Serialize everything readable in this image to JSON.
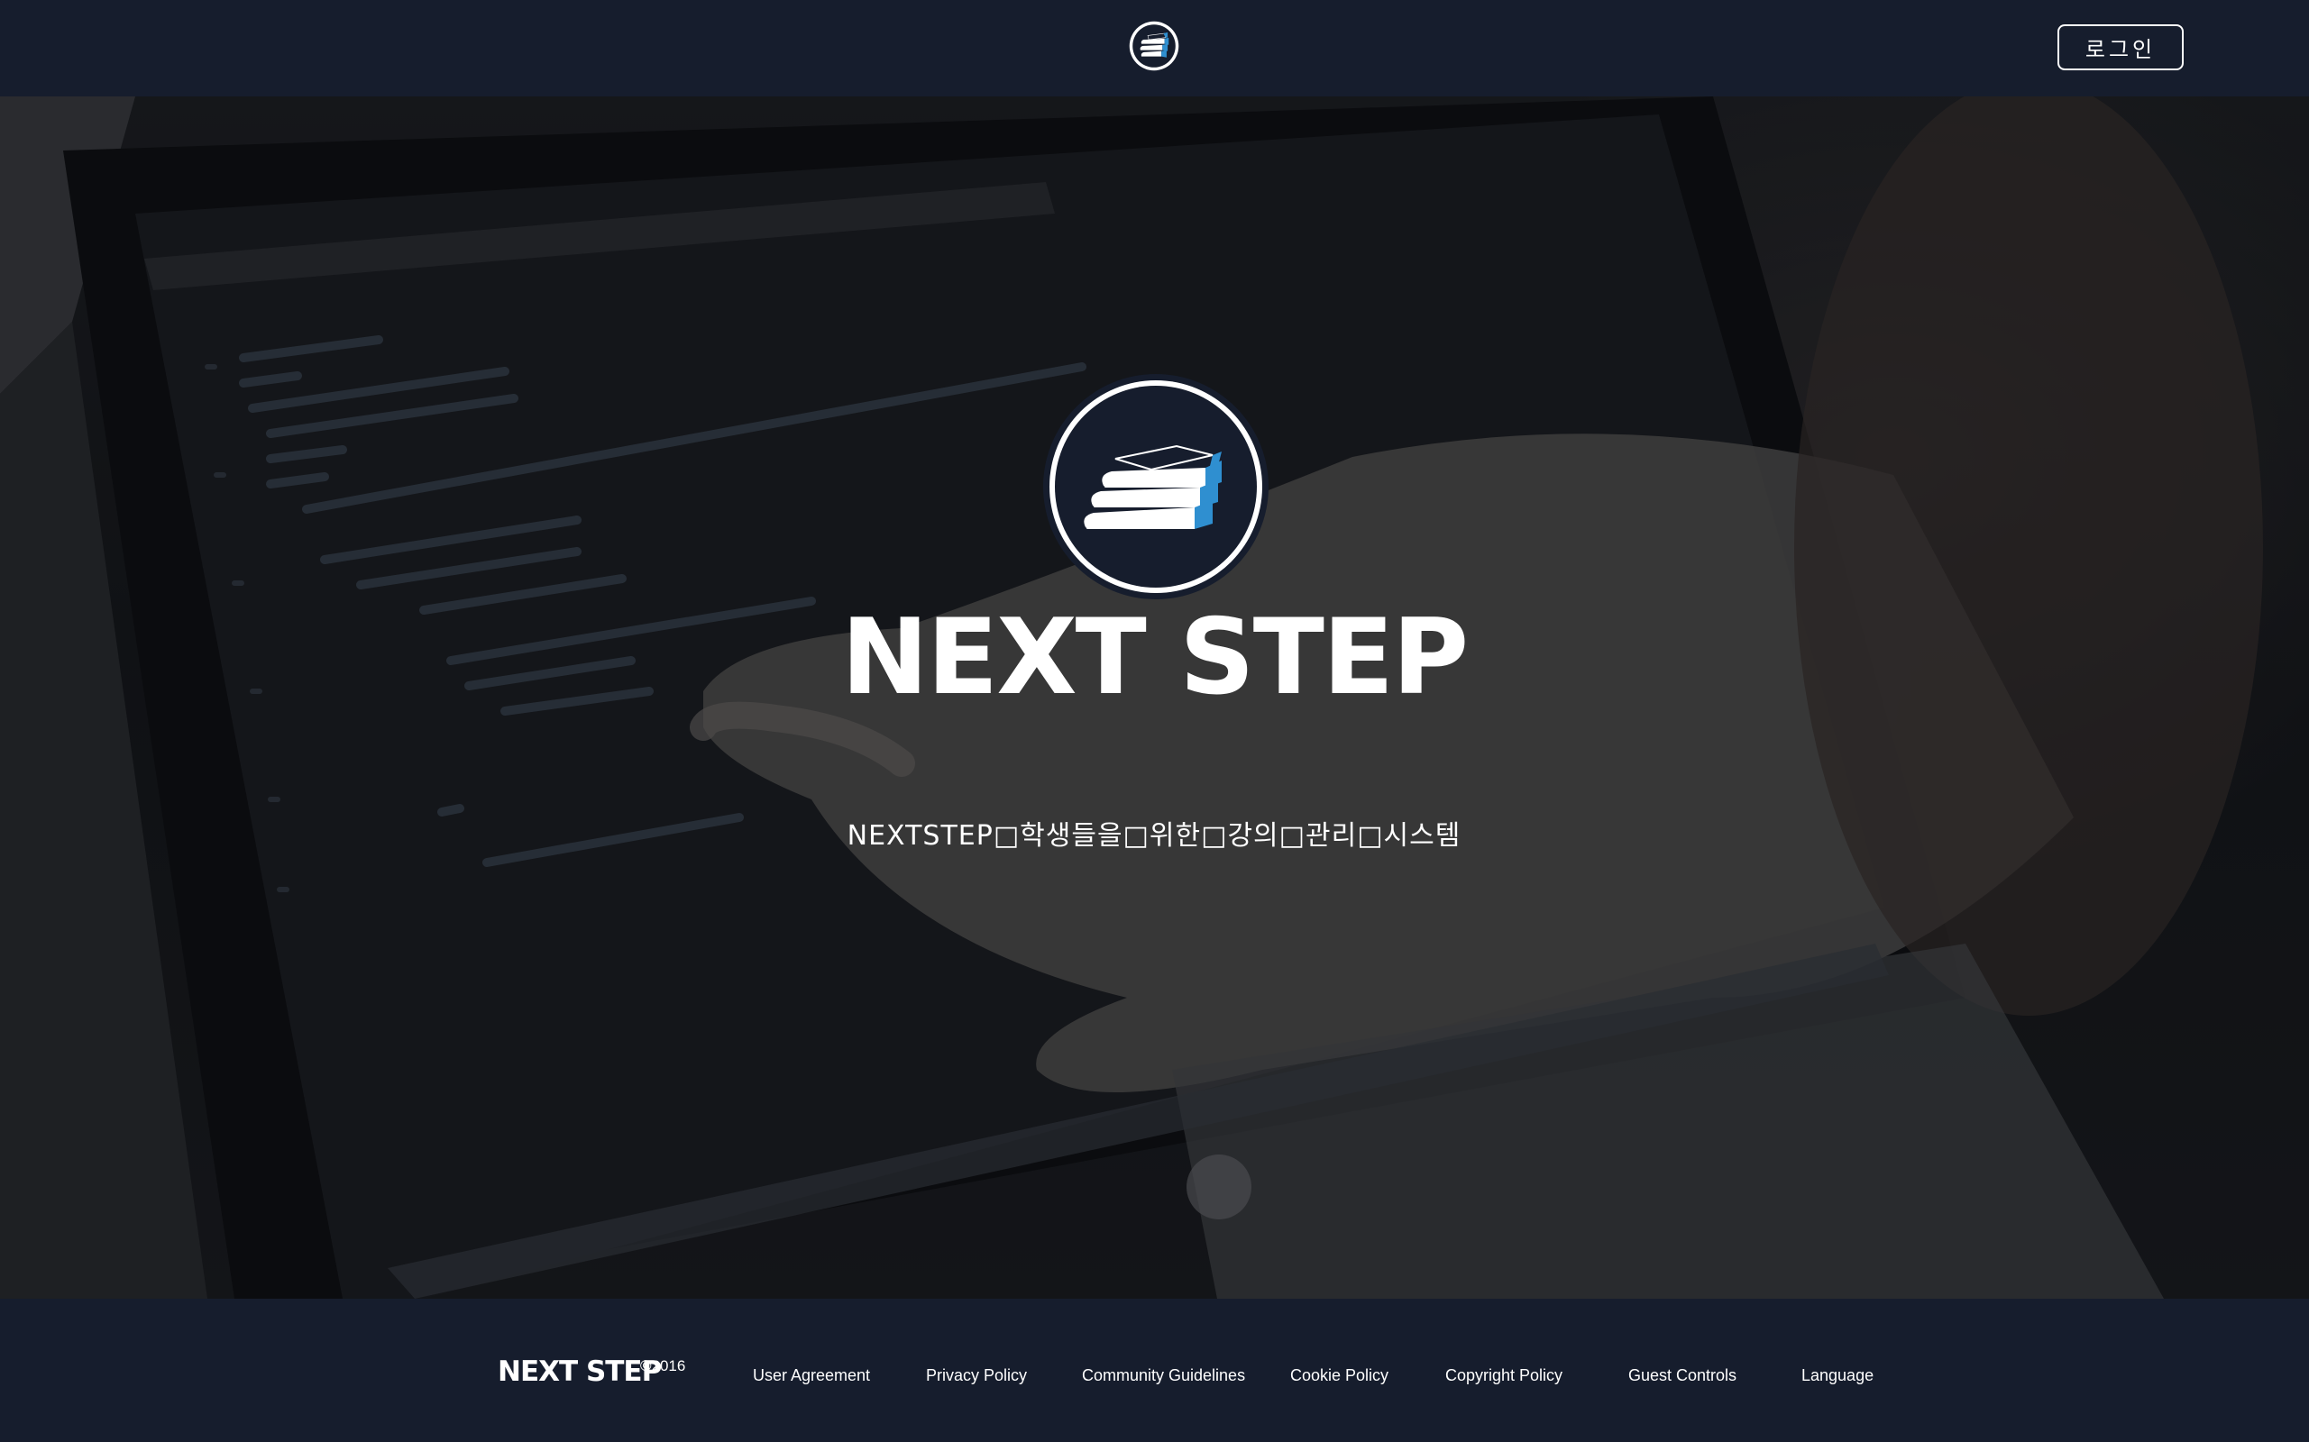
{
  "header": {
    "logo_icon": "book-stack-logo-icon",
    "login_label": "로그인"
  },
  "hero": {
    "background_description_icon": "laptop-code-photo",
    "title": "NEXT STEP",
    "subtitle": "NEXTSTEP□학생들을□위한□강의□관리□시스템"
  },
  "footer": {
    "brand": "NEXT STEP",
    "copyright": "©2016",
    "links": [
      {
        "label": "User Agreement"
      },
      {
        "label": "Privacy Policy"
      },
      {
        "label": "Community Guidelines"
      },
      {
        "label": "Cookie Policy"
      },
      {
        "label": "Copyright Policy"
      },
      {
        "label": "Guest Controls"
      },
      {
        "label": "Language"
      }
    ]
  },
  "colors": {
    "navy": "#161d2d",
    "accent_blue": "#2f8fd0",
    "white": "#ffffff"
  }
}
